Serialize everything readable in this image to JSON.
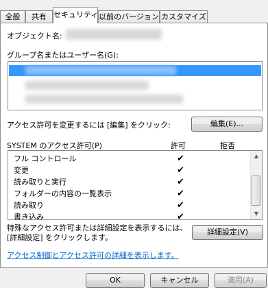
{
  "tabs": [
    {
      "label": "全般"
    },
    {
      "label": "共有"
    },
    {
      "label": "セキュリティ"
    },
    {
      "label": "以前のバージョン"
    },
    {
      "label": "カスタマイズ"
    }
  ],
  "object_name_label": "オブジェクト名:",
  "group_label": "グループ名またはユーザー名(G):",
  "change_prompt": "アクセス許可を変更するには [編集] をクリック:",
  "edit_button": "編集(E)...",
  "permissions": {
    "title": "SYSTEM のアクセス許可(P)",
    "allow_header": "許可",
    "deny_header": "拒否",
    "rows": [
      {
        "name": "フル コントロール",
        "allow": "✔"
      },
      {
        "name": "変更",
        "allow": "✔"
      },
      {
        "name": "読み取りと実行",
        "allow": "✔"
      },
      {
        "name": "フォルダーの内容の一覧表示",
        "allow": "✔"
      },
      {
        "name": "読み取り",
        "allow": "✔"
      },
      {
        "name": "書き込み",
        "allow": "✔"
      }
    ]
  },
  "advanced_text_line1": "特殊なアクセス許可または詳細設定を表示するには、",
  "advanced_text_line2": "[詳細設定] をクリックします。",
  "advanced_button": "詳細設定(V)",
  "help_link": "アクセス制御とアクセス許可の詳細を表示します。",
  "footer": {
    "ok": "OK",
    "cancel": "キャンセル",
    "apply": "適用(A)"
  }
}
